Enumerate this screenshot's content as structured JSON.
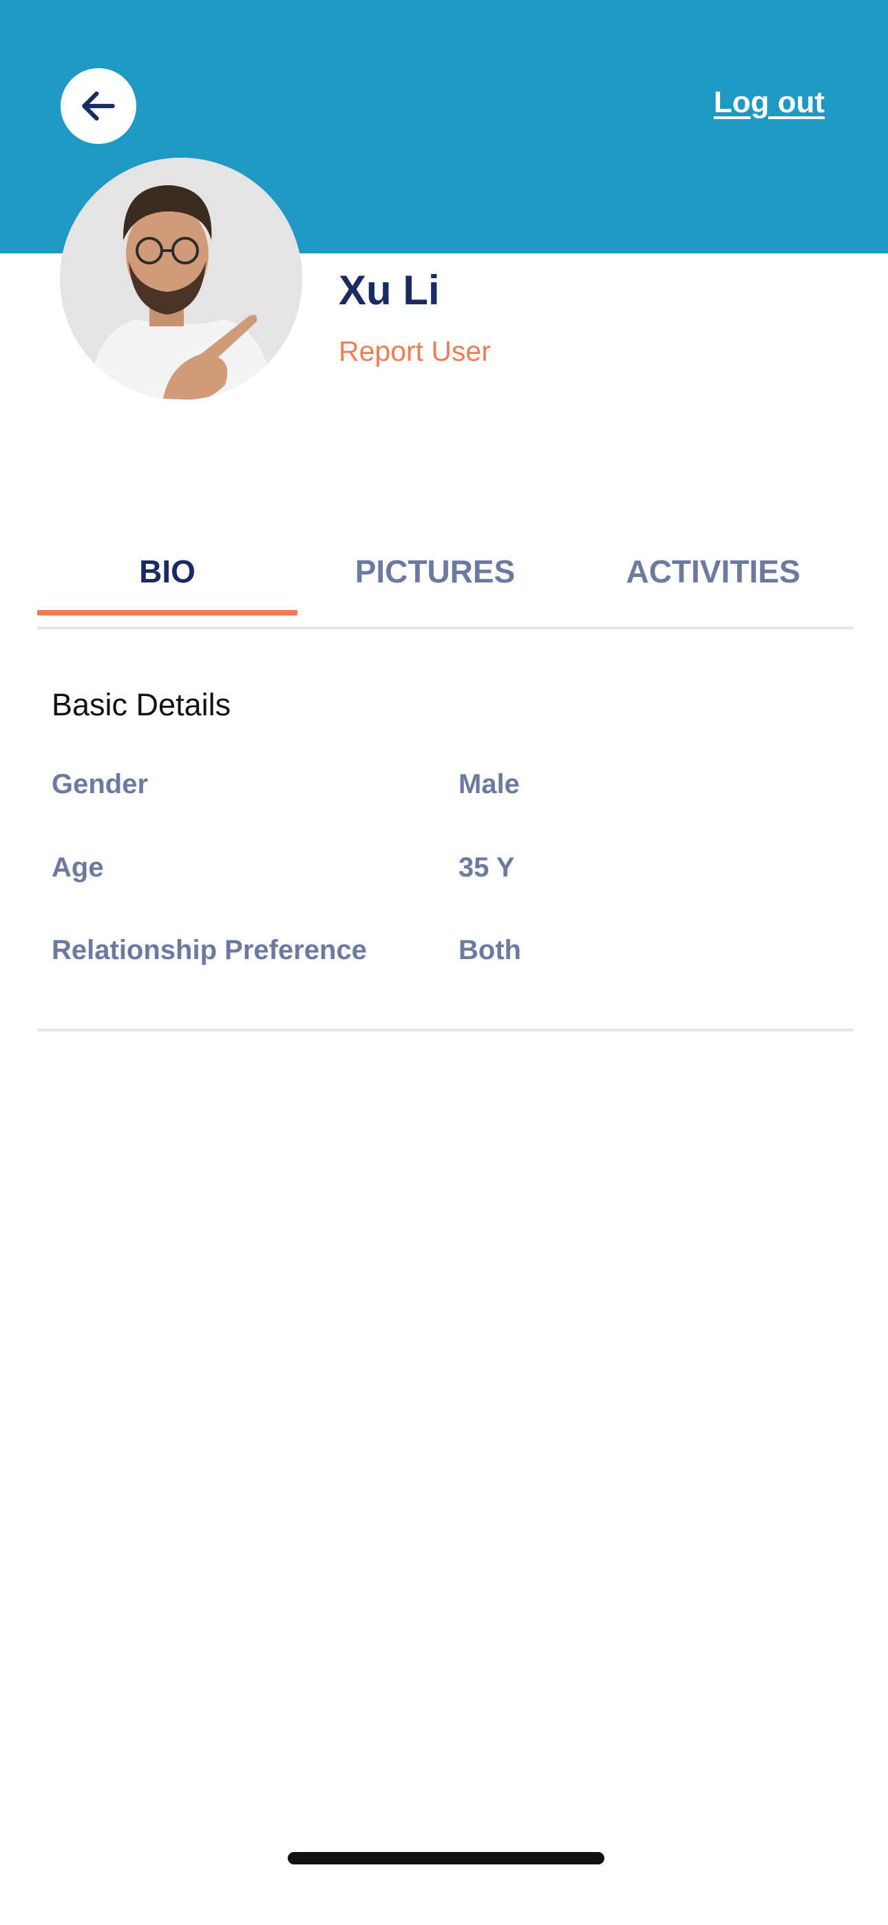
{
  "header": {
    "back_icon": "arrow-left-icon",
    "logout_label": "Log out",
    "background_color": "#1f99c4"
  },
  "profile": {
    "avatar_icon": "user-photo",
    "name": "Xu Li",
    "report_label": "Report User",
    "report_color": "#ef7d52"
  },
  "tabs": [
    {
      "label": "BIO",
      "active": true
    },
    {
      "label": "PICTURES",
      "active": false
    },
    {
      "label": "ACTIVITIES",
      "active": false
    }
  ],
  "details": {
    "title": "Basic Details",
    "rows": [
      {
        "label": "Gender",
        "value": "Male"
      },
      {
        "label": "Age",
        "value": "35 Y"
      },
      {
        "label": "Relationship Preference",
        "value": "Both"
      }
    ]
  },
  "colors": {
    "accent": "#ee7b52",
    "navy": "#1b2a63",
    "muted": "#6c7aa0"
  }
}
